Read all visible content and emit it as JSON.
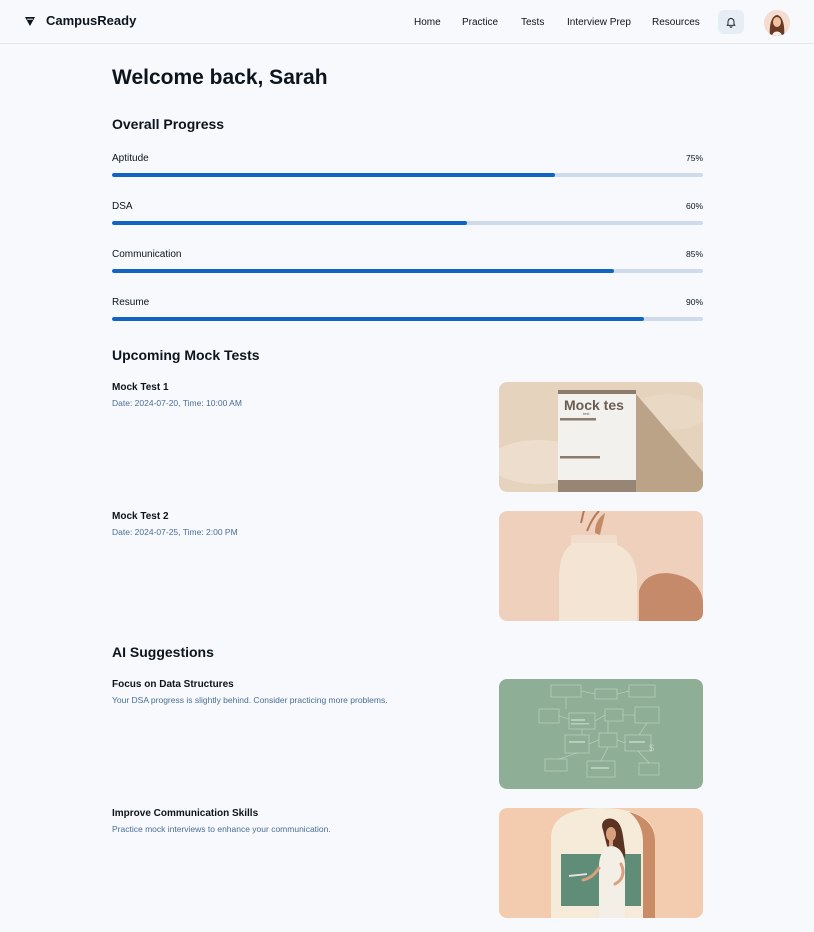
{
  "app": {
    "name": "CampusReady",
    "logo_icon": "diamond-logo-icon"
  },
  "nav": {
    "items": [
      "Home",
      "Practice",
      "Tests",
      "Interview Prep",
      "Resources"
    ]
  },
  "header_icons": {
    "notification": "bell-icon",
    "avatar": "user-avatar"
  },
  "welcome": "Welcome back, Sarah",
  "progress": {
    "title": "Overall Progress",
    "items": [
      {
        "label": "Aptitude",
        "value_text": "75%",
        "value": 0.75
      },
      {
        "label": "DSA",
        "value_text": "60%",
        "value": 0.6
      },
      {
        "label": "Communication",
        "value_text": "85%",
        "value": 0.85
      },
      {
        "label": "Resume",
        "value_text": "90%",
        "value": 0.9
      }
    ]
  },
  "mock_tests": {
    "title": "Upcoming Mock Tests",
    "items": [
      {
        "title": "Mock Test 1",
        "detail": "Date: 2024-07-20, Time: 10:00 AM",
        "image_text": "Mock tes",
        "image_subtext": "test"
      },
      {
        "title": "Mock Test 2",
        "detail": "Date: 2024-07-25, Time: 2:00 PM"
      }
    ]
  },
  "suggestions": {
    "title": "AI Suggestions",
    "items": [
      {
        "title": "Focus on Data Structures",
        "detail": "Your DSA progress is slightly behind. Consider practicing more problems."
      },
      {
        "title": "Improve Communication Skills",
        "detail": "Practice mock interviews to enhance your communication."
      }
    ]
  },
  "colors": {
    "accent": "#1264c2",
    "track": "#cfdbe8",
    "secondary_text": "#4a6e96",
    "background": "#f7f9fc"
  }
}
